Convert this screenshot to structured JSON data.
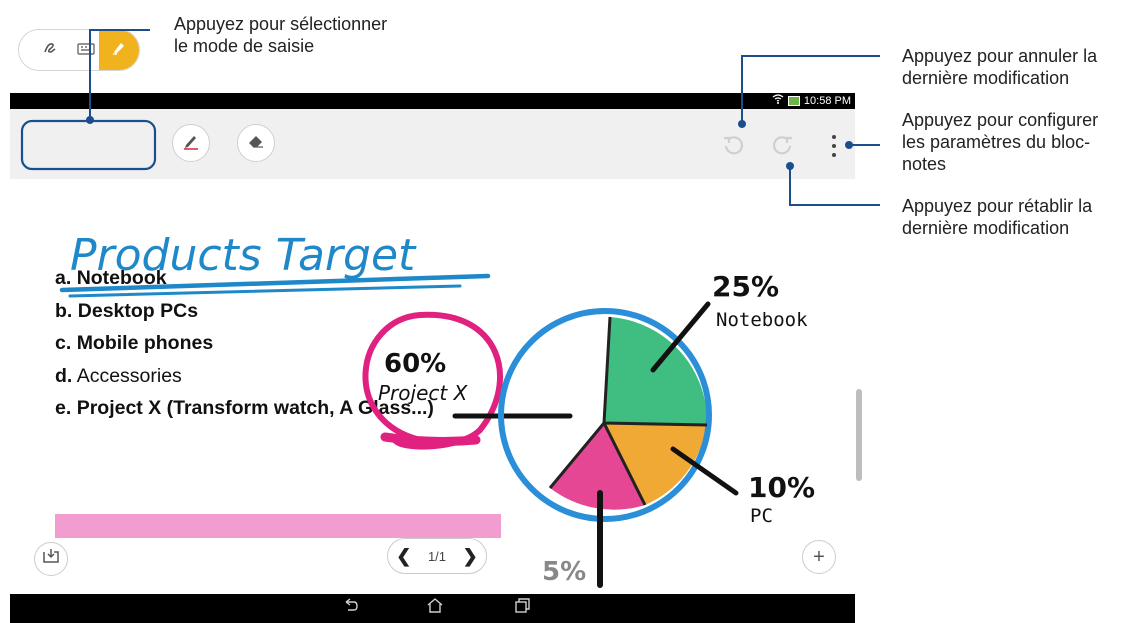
{
  "callouts": {
    "input_mode": [
      "Appuyez pour sélectionner",
      "le mode de saisie"
    ],
    "undo": [
      "Appuyez pour annuler la",
      "dernière modification"
    ],
    "settings": [
      "Appuyez pour configurer",
      "les paramètres du bloc-",
      "notes"
    ],
    "redo": [
      "Appuyez pour rétablir la",
      "dernière modification"
    ]
  },
  "status_bar": {
    "time": "10:58 PM"
  },
  "note": {
    "title": "Products Target",
    "list": [
      {
        "letter": "a.",
        "text": "Notebook"
      },
      {
        "letter": "b.",
        "text": "Desktop PCs"
      },
      {
        "letter": "c.",
        "text": "Mobile phones"
      },
      {
        "letter": "d.",
        "text": "Accessories"
      },
      {
        "letter": "e.",
        "text": "Project X (Transform watch, A Glass...)"
      }
    ],
    "annotations": {
      "project_x_pct": "60%",
      "project_x_label": "Project X",
      "notebook_pct": "25%",
      "notebook_label": "Notebook",
      "pc_pct": "10%",
      "pc_label": "PC",
      "other_pct": "5%"
    }
  },
  "pager": {
    "page": "1/1"
  },
  "colors": {
    "highlight_yellow": "#f0b21d",
    "title_blue": "#1e88c8",
    "pie_green": "#2bb673",
    "pie_orange": "#f0a020",
    "pie_pink": "#e3338a",
    "callout_line": "#1a4e8c"
  },
  "icons": {
    "handwriting": "handwriting-icon",
    "keyboard": "keyboard-icon",
    "highlighter": "highlighter-icon",
    "pen": "pen-icon",
    "eraser": "eraser-icon",
    "undo": "undo-icon",
    "redo": "redo-icon",
    "more": "more-vert-icon",
    "import": "import-icon",
    "add": "add-icon"
  }
}
